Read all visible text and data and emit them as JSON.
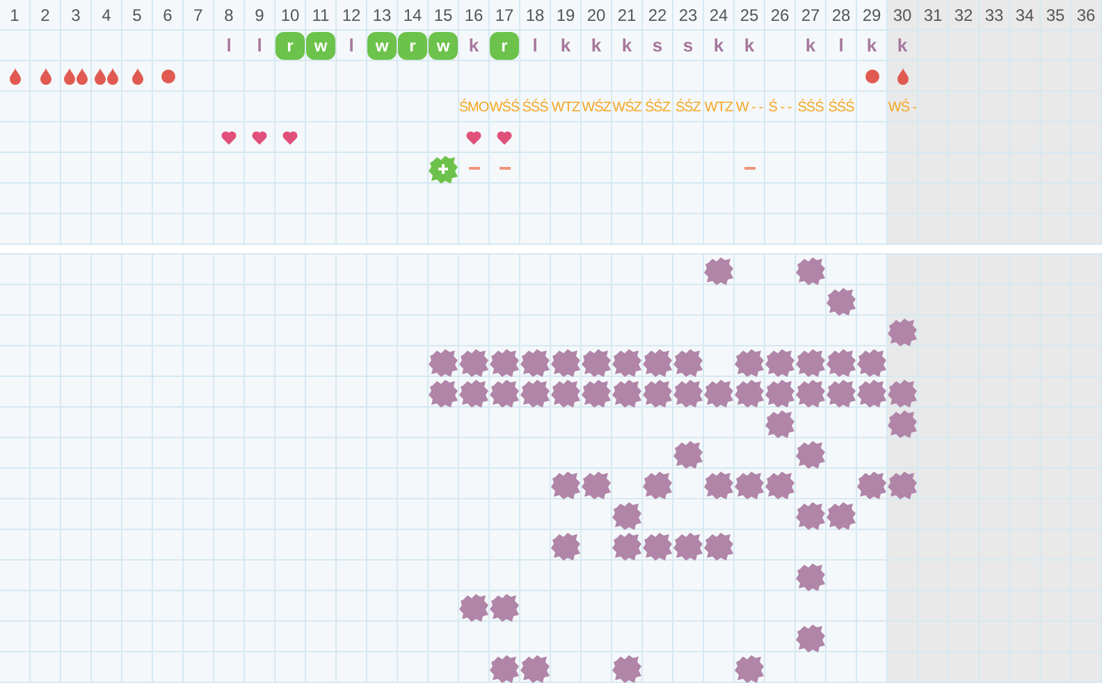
{
  "days": [
    {
      "label": "1",
      "available": true,
      "drop": {
        "kind": "drop"
      }
    },
    {
      "label": "2",
      "available": true,
      "drop": {
        "kind": "drop"
      }
    },
    {
      "label": "3",
      "available": true,
      "drop": {
        "kind": "double"
      }
    },
    {
      "label": "4",
      "available": true,
      "drop": {
        "kind": "double"
      }
    },
    {
      "label": "5",
      "available": true,
      "drop": {
        "kind": "drop"
      }
    },
    {
      "label": "6",
      "available": true,
      "drop": {
        "kind": "dot"
      }
    },
    {
      "label": "7",
      "available": true
    },
    {
      "label": "8",
      "available": true,
      "letter": {
        "text": "l",
        "highlighted": false
      },
      "heart": true
    },
    {
      "label": "9",
      "available": true,
      "letter": {
        "text": "l",
        "highlighted": false
      },
      "heart": true
    },
    {
      "label": "10",
      "available": true,
      "letter": {
        "text": "r",
        "highlighted": true
      },
      "heart": true
    },
    {
      "label": "11",
      "available": true,
      "letter": {
        "text": "w",
        "highlighted": true
      }
    },
    {
      "label": "12",
      "available": true,
      "letter": {
        "text": "l",
        "highlighted": false
      }
    },
    {
      "label": "13",
      "available": true,
      "letter": {
        "text": "w",
        "highlighted": true
      }
    },
    {
      "label": "14",
      "available": true,
      "letter": {
        "text": "r",
        "highlighted": true
      }
    },
    {
      "label": "15",
      "available": true,
      "letter": {
        "text": "w",
        "highlighted": true
      },
      "mark": {
        "kind": "plus"
      }
    },
    {
      "label": "16",
      "available": true,
      "letter": {
        "text": "k",
        "highlighted": false
      },
      "code": "ŚMO",
      "heart": true,
      "mark": {
        "kind": "dash"
      }
    },
    {
      "label": "17",
      "available": true,
      "letter": {
        "text": "r",
        "highlighted": true
      },
      "code": "WŚŚ",
      "heart": true,
      "mark": {
        "kind": "dash"
      }
    },
    {
      "label": "18",
      "available": true,
      "letter": {
        "text": "l",
        "highlighted": false
      },
      "code": "ŚŚŚ"
    },
    {
      "label": "19",
      "available": true,
      "letter": {
        "text": "k",
        "highlighted": false
      },
      "code": "WTZ"
    },
    {
      "label": "20",
      "available": true,
      "letter": {
        "text": "k",
        "highlighted": false
      },
      "code": "WŚZ"
    },
    {
      "label": "21",
      "available": true,
      "letter": {
        "text": "k",
        "highlighted": false
      },
      "code": "WŚZ"
    },
    {
      "label": "22",
      "available": true,
      "letter": {
        "text": "s",
        "highlighted": false
      },
      "code": "ŚŚZ"
    },
    {
      "label": "23",
      "available": true,
      "letter": {
        "text": "s",
        "highlighted": false
      },
      "code": "ŚŚZ"
    },
    {
      "label": "24",
      "available": true,
      "letter": {
        "text": "k",
        "highlighted": false
      },
      "code": "WTZ"
    },
    {
      "label": "25",
      "available": true,
      "letter": {
        "text": "k",
        "highlighted": false
      },
      "code": "W - -",
      "mark": {
        "kind": "dash"
      }
    },
    {
      "label": "26",
      "available": true,
      "code": "Ś - -"
    },
    {
      "label": "27",
      "available": true,
      "letter": {
        "text": "k",
        "highlighted": false
      },
      "code": "ŚŚŚ"
    },
    {
      "label": "28",
      "available": true,
      "letter": {
        "text": "l",
        "highlighted": false
      },
      "code": "ŚŚŚ"
    },
    {
      "label": "29",
      "available": true,
      "letter": {
        "text": "k",
        "highlighted": false
      },
      "drop": {
        "kind": "dot"
      }
    },
    {
      "label": "30",
      "available": false,
      "letter": {
        "text": "k",
        "highlighted": false
      },
      "drop": {
        "kind": "drop"
      },
      "code": "WŚ -"
    },
    {
      "label": "31",
      "available": false
    },
    {
      "label": "32",
      "available": false
    },
    {
      "label": "33",
      "available": false
    },
    {
      "label": "34",
      "available": false
    },
    {
      "label": "35",
      "available": false
    },
    {
      "label": "36",
      "available": false
    }
  ],
  "chart_rows": [
    {
      "marked": [
        false,
        false,
        false,
        false,
        false,
        false,
        false,
        false,
        false,
        false,
        false,
        false,
        false,
        false,
        false,
        false,
        false,
        false,
        false,
        false,
        false,
        false,
        false,
        true,
        false,
        false,
        true,
        false,
        false,
        false,
        false,
        false,
        false,
        false,
        false,
        false
      ]
    },
    {
      "marked": [
        false,
        false,
        false,
        false,
        false,
        false,
        false,
        false,
        false,
        false,
        false,
        false,
        false,
        false,
        false,
        false,
        false,
        false,
        false,
        false,
        false,
        false,
        false,
        false,
        false,
        false,
        false,
        true,
        false,
        false,
        false,
        false,
        false,
        false,
        false,
        false
      ]
    },
    {
      "marked": [
        false,
        false,
        false,
        false,
        false,
        false,
        false,
        false,
        false,
        false,
        false,
        false,
        false,
        false,
        false,
        false,
        false,
        false,
        false,
        false,
        false,
        false,
        false,
        false,
        false,
        false,
        false,
        false,
        false,
        true,
        false,
        false,
        false,
        false,
        false,
        false
      ]
    },
    {
      "marked": [
        false,
        false,
        false,
        false,
        false,
        false,
        false,
        false,
        false,
        false,
        false,
        false,
        false,
        false,
        true,
        true,
        true,
        true,
        true,
        true,
        true,
        true,
        true,
        false,
        true,
        true,
        true,
        true,
        true,
        false,
        false,
        false,
        false,
        false,
        false,
        false
      ]
    },
    {
      "marked": [
        false,
        false,
        false,
        false,
        false,
        false,
        false,
        false,
        false,
        false,
        false,
        false,
        false,
        false,
        true,
        true,
        true,
        true,
        true,
        true,
        true,
        true,
        true,
        true,
        true,
        true,
        true,
        true,
        true,
        true,
        false,
        false,
        false,
        false,
        false,
        false
      ]
    },
    {
      "marked": [
        false,
        false,
        false,
        false,
        false,
        false,
        false,
        false,
        false,
        false,
        false,
        false,
        false,
        false,
        false,
        false,
        false,
        false,
        false,
        false,
        false,
        false,
        false,
        false,
        false,
        true,
        false,
        false,
        false,
        true,
        false,
        false,
        false,
        false,
        false,
        false
      ]
    },
    {
      "marked": [
        false,
        false,
        false,
        false,
        false,
        false,
        false,
        false,
        false,
        false,
        false,
        false,
        false,
        false,
        false,
        false,
        false,
        false,
        false,
        false,
        false,
        false,
        true,
        false,
        false,
        false,
        true,
        false,
        false,
        false,
        false,
        false,
        false,
        false,
        false,
        false
      ]
    },
    {
      "marked": [
        false,
        false,
        false,
        false,
        false,
        false,
        false,
        false,
        false,
        false,
        false,
        false,
        false,
        false,
        false,
        false,
        false,
        false,
        true,
        true,
        false,
        true,
        false,
        true,
        true,
        true,
        false,
        false,
        true,
        true,
        false,
        false,
        false,
        false,
        false,
        false
      ]
    },
    {
      "marked": [
        false,
        false,
        false,
        false,
        false,
        false,
        false,
        false,
        false,
        false,
        false,
        false,
        false,
        false,
        false,
        false,
        false,
        false,
        false,
        false,
        true,
        false,
        false,
        false,
        false,
        false,
        true,
        true,
        false,
        false,
        false,
        false,
        false,
        false,
        false,
        false
      ]
    },
    {
      "marked": [
        false,
        false,
        false,
        false,
        false,
        false,
        false,
        false,
        false,
        false,
        false,
        false,
        false,
        false,
        false,
        false,
        false,
        false,
        true,
        false,
        true,
        true,
        true,
        true,
        false,
        false,
        false,
        false,
        false,
        false,
        false,
        false,
        false,
        false,
        false,
        false
      ]
    },
    {
      "marked": [
        false,
        false,
        false,
        false,
        false,
        false,
        false,
        false,
        false,
        false,
        false,
        false,
        false,
        false,
        false,
        false,
        false,
        false,
        false,
        false,
        false,
        false,
        false,
        false,
        false,
        false,
        true,
        false,
        false,
        false,
        false,
        false,
        false,
        false,
        false,
        false
      ]
    },
    {
      "marked": [
        false,
        false,
        false,
        false,
        false,
        false,
        false,
        false,
        false,
        false,
        false,
        false,
        false,
        false,
        false,
        true,
        true,
        false,
        false,
        false,
        false,
        false,
        false,
        false,
        false,
        false,
        false,
        false,
        false,
        false,
        false,
        false,
        false,
        false,
        false,
        false
      ]
    },
    {
      "marked": [
        false,
        false,
        false,
        false,
        false,
        false,
        false,
        false,
        false,
        false,
        false,
        false,
        false,
        false,
        false,
        false,
        false,
        false,
        false,
        false,
        false,
        false,
        false,
        false,
        false,
        false,
        true,
        false,
        false,
        false,
        false,
        false,
        false,
        false,
        false,
        false
      ]
    },
    {
      "marked": [
        false,
        false,
        false,
        false,
        false,
        false,
        false,
        false,
        false,
        false,
        false,
        false,
        false,
        false,
        false,
        false,
        true,
        true,
        false,
        false,
        true,
        false,
        false,
        false,
        true,
        false,
        false,
        false,
        false,
        false,
        false,
        false,
        false,
        false,
        false,
        false
      ]
    }
  ]
}
